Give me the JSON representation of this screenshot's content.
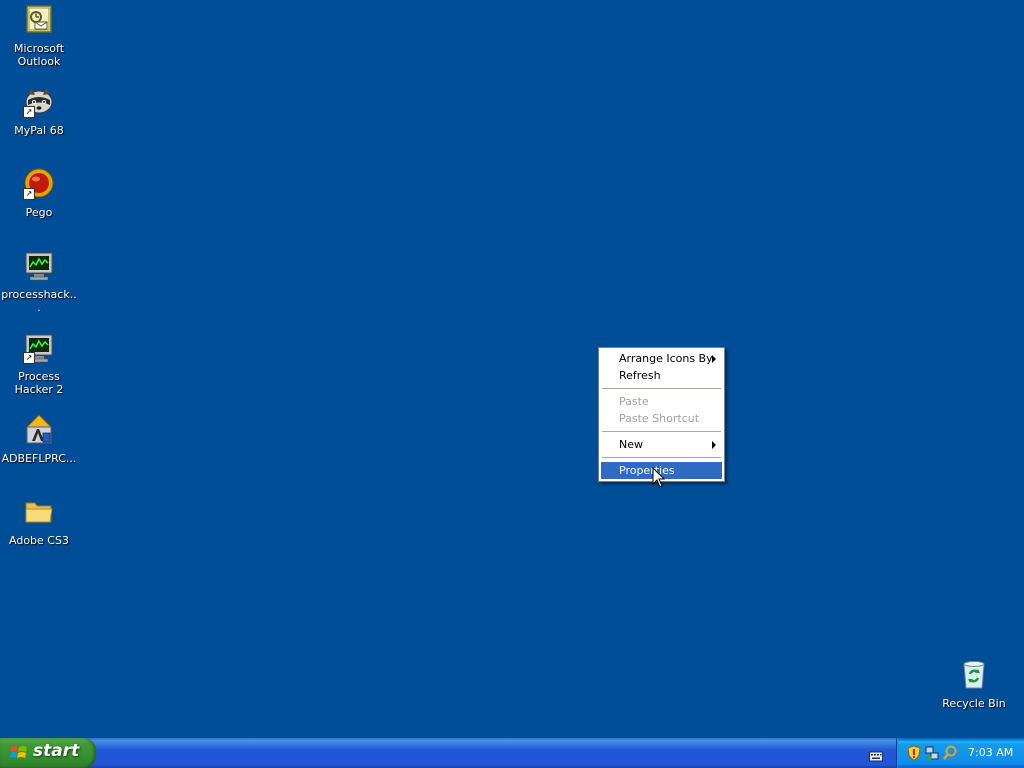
{
  "desktop": {
    "background_color": "#004e98",
    "icons": [
      {
        "label": "Microsoft Outlook",
        "icon": "outlook-icon"
      },
      {
        "label": "MyPal 68",
        "icon": "mypal-raccoon-icon"
      },
      {
        "label": "Pego",
        "icon": "pego-icon"
      },
      {
        "label": "processhack...",
        "icon": "process-hacker-icon"
      },
      {
        "label": "Process Hacker 2",
        "icon": "process-hacker-icon"
      },
      {
        "label": "ADBEFLPRC...",
        "icon": "adobe-flash-installer-icon"
      },
      {
        "label": "Adobe CS3",
        "icon": "folder-icon"
      },
      {
        "label": "Recycle Bin",
        "icon": "recycle-bin-icon"
      }
    ]
  },
  "context_menu": {
    "items": {
      "arrange_icons_by": "Arrange Icons By",
      "refresh": "Refresh",
      "paste": "Paste",
      "paste_shortcut": "Paste Shortcut",
      "new": "New",
      "properties": "Properties"
    },
    "highlighted": "Properties",
    "disabled": [
      "Paste",
      "Paste Shortcut"
    ],
    "highlight_color": "#316ac5"
  },
  "taskbar": {
    "start_label": "start",
    "start_color": "#3f9a3a",
    "bar_color": "#2157d7",
    "tray_color": "#1290e8",
    "tray_icons": [
      "keyboard-icon",
      "security-shield-icon",
      "network-icon",
      "search-icon"
    ],
    "clock": "7:03 AM"
  }
}
